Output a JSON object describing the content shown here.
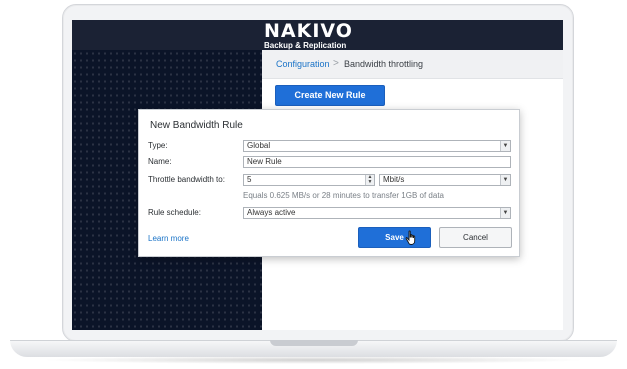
{
  "app": {
    "logo_text": "NAKIVO",
    "logo_tagline": "Backup & Replication"
  },
  "breadcrumb": {
    "parent": "Configuration",
    "separator": ">",
    "current": "Bandwidth throttling"
  },
  "toolbar": {
    "create_button": "Create New Rule"
  },
  "dialog": {
    "title": "New Bandwidth Rule",
    "type": {
      "label": "Type:",
      "value": "Global"
    },
    "name": {
      "label": "Name:",
      "value": "New Rule"
    },
    "throttle": {
      "label": "Throttle bandwidth to:",
      "value": "5",
      "unit": "Mbit/s"
    },
    "hint": "Equals 0.625 MB/s or 28 minutes to transfer 1GB of data",
    "schedule": {
      "label": "Rule schedule:",
      "value": "Always active"
    },
    "learn_more": "Learn more",
    "save": "Save",
    "cancel": "Cancel"
  },
  "colors": {
    "accent": "#1f6fd8",
    "topbar": "#1b2234",
    "sidebar": "#0b1428",
    "link": "#1a73c7"
  },
  "icons": [
    "chevron-down-icon",
    "spinner-arrows-icon",
    "hand-pointer-icon"
  ]
}
